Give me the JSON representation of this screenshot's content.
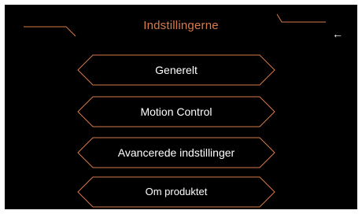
{
  "header": {
    "title": "Indstillingerne",
    "back_icon": "arrow-left-icon",
    "back_glyph": "←"
  },
  "menu": {
    "items": [
      {
        "label": "Generelt"
      },
      {
        "label": "Motion Control"
      },
      {
        "label": "Avancerede indstillinger"
      },
      {
        "label": "Om produktet"
      }
    ]
  },
  "colors": {
    "background": "#000000",
    "accent": "#d97a4a",
    "text": "#ffffff"
  }
}
